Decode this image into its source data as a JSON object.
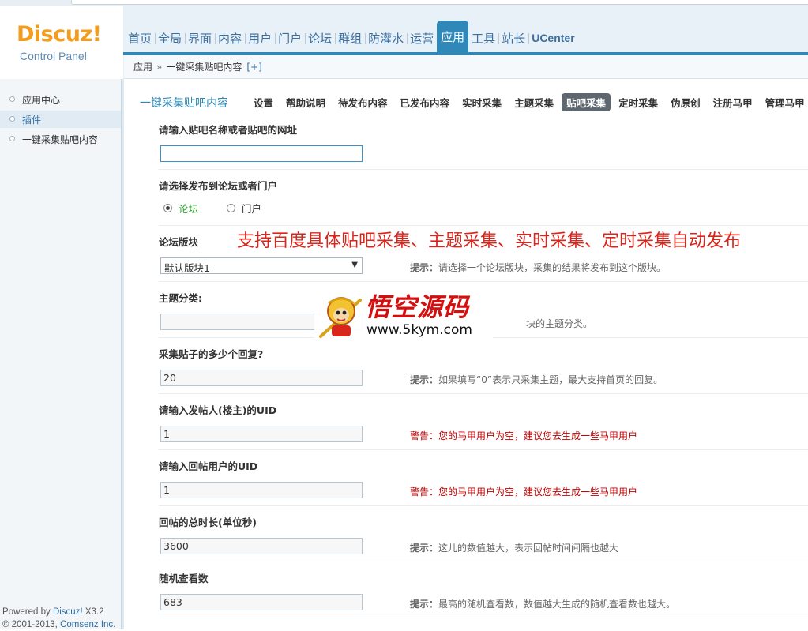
{
  "logo": {
    "brand": "Discuz!",
    "sub": "Control Panel"
  },
  "nav": [
    "首页",
    "全局",
    "界面",
    "内容",
    "用户",
    "门户",
    "论坛",
    "群组",
    "防灌水",
    "运营",
    "应用",
    "工具",
    "站长",
    "UCenter"
  ],
  "nav_active": "应用",
  "breadcrumb": {
    "root": "应用",
    "sep": "»",
    "current": "一键采集贴吧内容",
    "add": "[+]"
  },
  "sidebar": {
    "items": [
      "应用中心",
      "插件",
      "一键采集贴吧内容"
    ],
    "active": "插件",
    "footer_prefix": "Powered by ",
    "footer_link": "Discuz!",
    "footer_version": " X3.2",
    "footer_copy_prefix": "© 2001-2013, ",
    "footer_copy_link": "Comsenz Inc."
  },
  "plugin_title": "一键采集贴吧内容",
  "tabs": [
    "设置",
    "帮助说明",
    "待发布内容",
    "已发布内容",
    "实时采集",
    "主题采集",
    "贴吧采集",
    "定时采集",
    "伪原创",
    "注册马甲",
    "管理马甲"
  ],
  "tab_active": "贴吧采集",
  "form": {
    "tieba_label": "请输入贴吧名称或者贴吧的网址",
    "tieba_value": "",
    "publish_label": "请选择发布到论坛或者门户",
    "publish_options": [
      "论坛",
      "门户"
    ],
    "publish_selected": "论坛",
    "forum_label": "论坛版块",
    "forum_value": "默认版块1",
    "forum_hint_prefix": "提示：",
    "forum_hint": "请选择一个论坛版块，采集的结果将发布到这个版块。",
    "topic_label": "主题分类:",
    "topic_value": "",
    "topic_hint": "块的主题分类。",
    "reply_count_label": "采集贴子的多少个回复?",
    "reply_count_value": "20",
    "reply_count_hint_prefix": "提示：",
    "reply_count_hint": "如果填写“0”表示只采集主题，最大支持首页的回复。",
    "poster_uid_label": "请输入发帖人(楼主)的UID",
    "poster_uid_value": "1",
    "poster_uid_warn": "警告：您的马甲用户为空，建议您去生成一些马甲用户",
    "reply_uid_label": "请输入回帖用户的UID",
    "reply_uid_value": "1",
    "reply_uid_warn": "警告：您的马甲用户为空，建议您去生成一些马甲用户",
    "duration_label": "回帖的总时长(单位秒)",
    "duration_value": "3600",
    "duration_hint_prefix": "提示：",
    "duration_hint": "这儿的数值越大，表示回帖时间间隔也越大",
    "views_label": "随机查看数",
    "views_value": "683",
    "views_hint_prefix": "提示：",
    "views_hint": "最高的随机查看数，数值越大生成的随机查看数也越大。"
  },
  "overlay_caption": "支持百度具体贴吧采集、主题采集、实时采集、定时采集自动发布",
  "watermark": {
    "title": "悟空源码",
    "url": "www.5kym.com"
  },
  "colors": {
    "accent": "#2f88b7",
    "logo": "#f29d1f",
    "warn": "#c00000",
    "caption": "#d9261c"
  }
}
